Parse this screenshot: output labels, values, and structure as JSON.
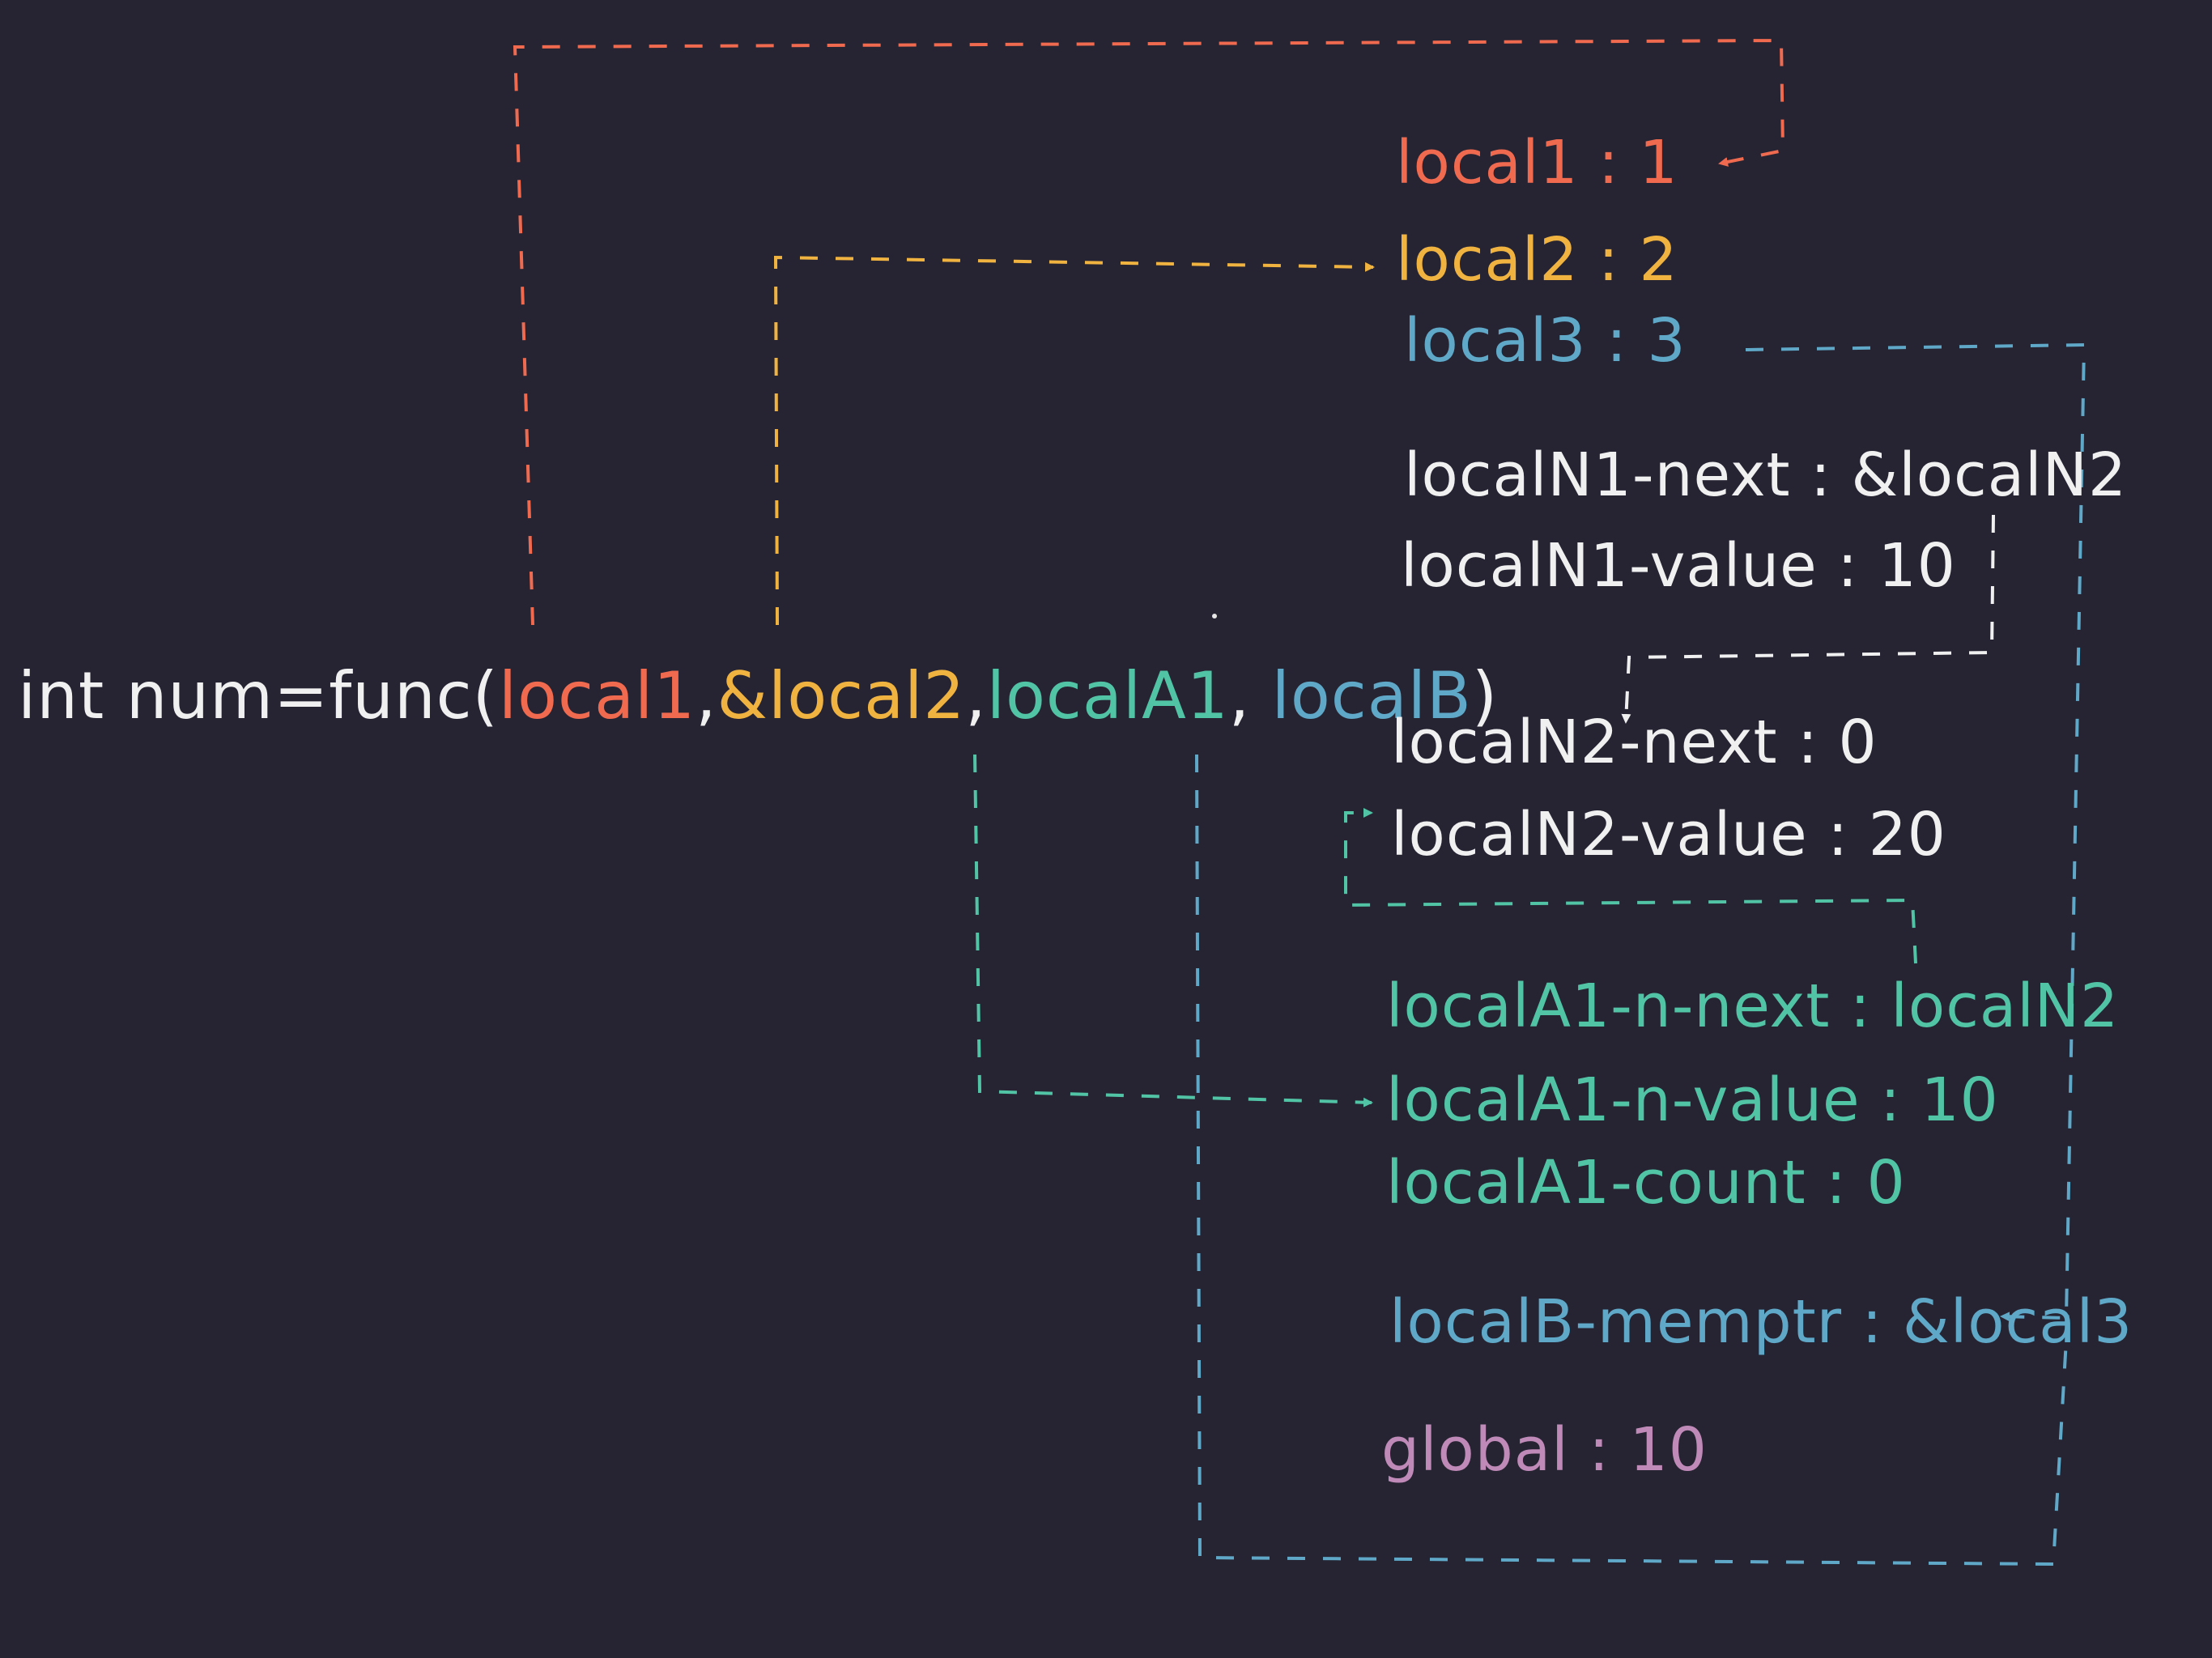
{
  "colors": {
    "background": "#262433",
    "white": "#f0f0f0",
    "local1": "#f06a4f",
    "local2": "#f0b340",
    "local3": "#5fa8c8",
    "localA1": "#52c4a6",
    "localB": "#5fa8c8",
    "global": "#c08ab8"
  },
  "call": {
    "prefix": "int num=func(",
    "arg1": "local1",
    "sep1": ",",
    "arg2": "&local2",
    "sep2": ",",
    "arg3": "localA1",
    "sep3": ", ",
    "arg4": "localB",
    "suffix": ")"
  },
  "memory": [
    {
      "name": "local1",
      "sep": " : ",
      "value": "1"
    },
    {
      "name": "local2",
      "sep": " : ",
      "value": "2"
    },
    {
      "name": "local3",
      "sep": " : ",
      "value": "3"
    },
    {
      "name": "localN1-next",
      "sep": " : ",
      "value": "&localN2"
    },
    {
      "name": "localN1-value",
      "sep": " : ",
      "value": "10"
    },
    {
      "name": "localN2-next",
      "sep": " : ",
      "value": "0"
    },
    {
      "name": "localN2-value",
      "sep": " : ",
      "value": "20"
    },
    {
      "name": "localA1-n-next",
      "sep": " : ",
      "value": "localN2"
    },
    {
      "name": "localA1-n-value",
      "sep": " : ",
      "value": "10"
    },
    {
      "name": "localA1-count",
      "sep": " : ",
      "value": "0"
    },
    {
      "name": "localB-memptr",
      "sep": " : ",
      "value": "&local3"
    },
    {
      "name": "global",
      "sep": " : ",
      "value": "10"
    }
  ]
}
